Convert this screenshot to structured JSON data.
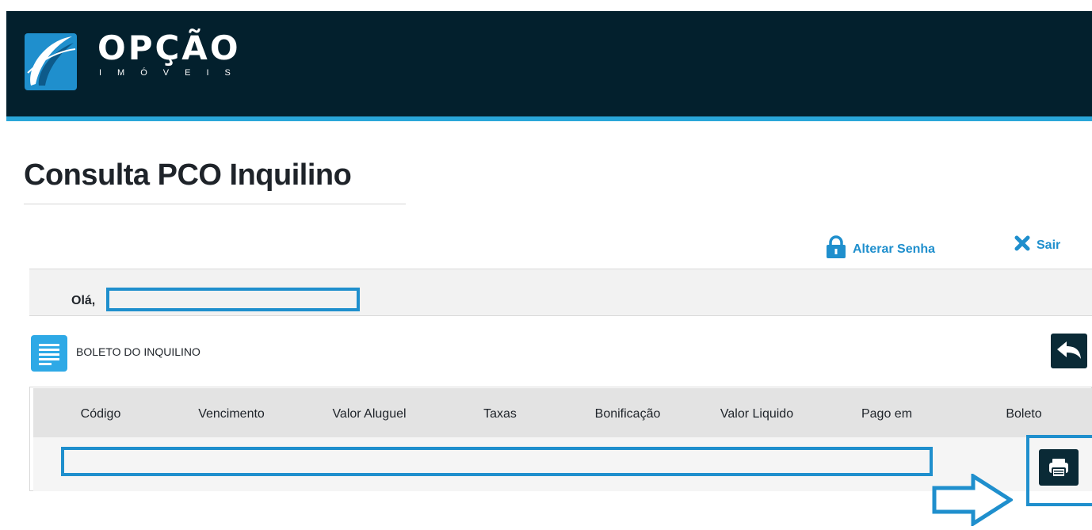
{
  "brand": {
    "name": "OPÇÃO",
    "subtitle": "IMÓVEIS"
  },
  "page": {
    "title": "Consulta PCO Inquilino"
  },
  "actions": {
    "change_password": "Alterar Senha",
    "logout": "Sair"
  },
  "greeting": {
    "label": "Olá,"
  },
  "section": {
    "title": "BOLETO DO INQUILINO"
  },
  "table": {
    "headers": [
      "Código",
      "Vencimento",
      "Valor Aluguel",
      "Taxas",
      "Bonificação",
      "Valor Liquido",
      "Pago em",
      "Boleto"
    ]
  },
  "icons": {
    "logo": "opcao-logo-icon",
    "change_password": "lock-icon",
    "logout": "close-icon",
    "section": "document-icon",
    "back": "reply-icon",
    "print": "printer-icon",
    "annotation": "arrow-right-icon"
  },
  "colors": {
    "header_bg": "#03202d",
    "accent": "#1f8fcd",
    "accent_light": "#2aa6d9",
    "dark_button": "#0a2a36"
  }
}
